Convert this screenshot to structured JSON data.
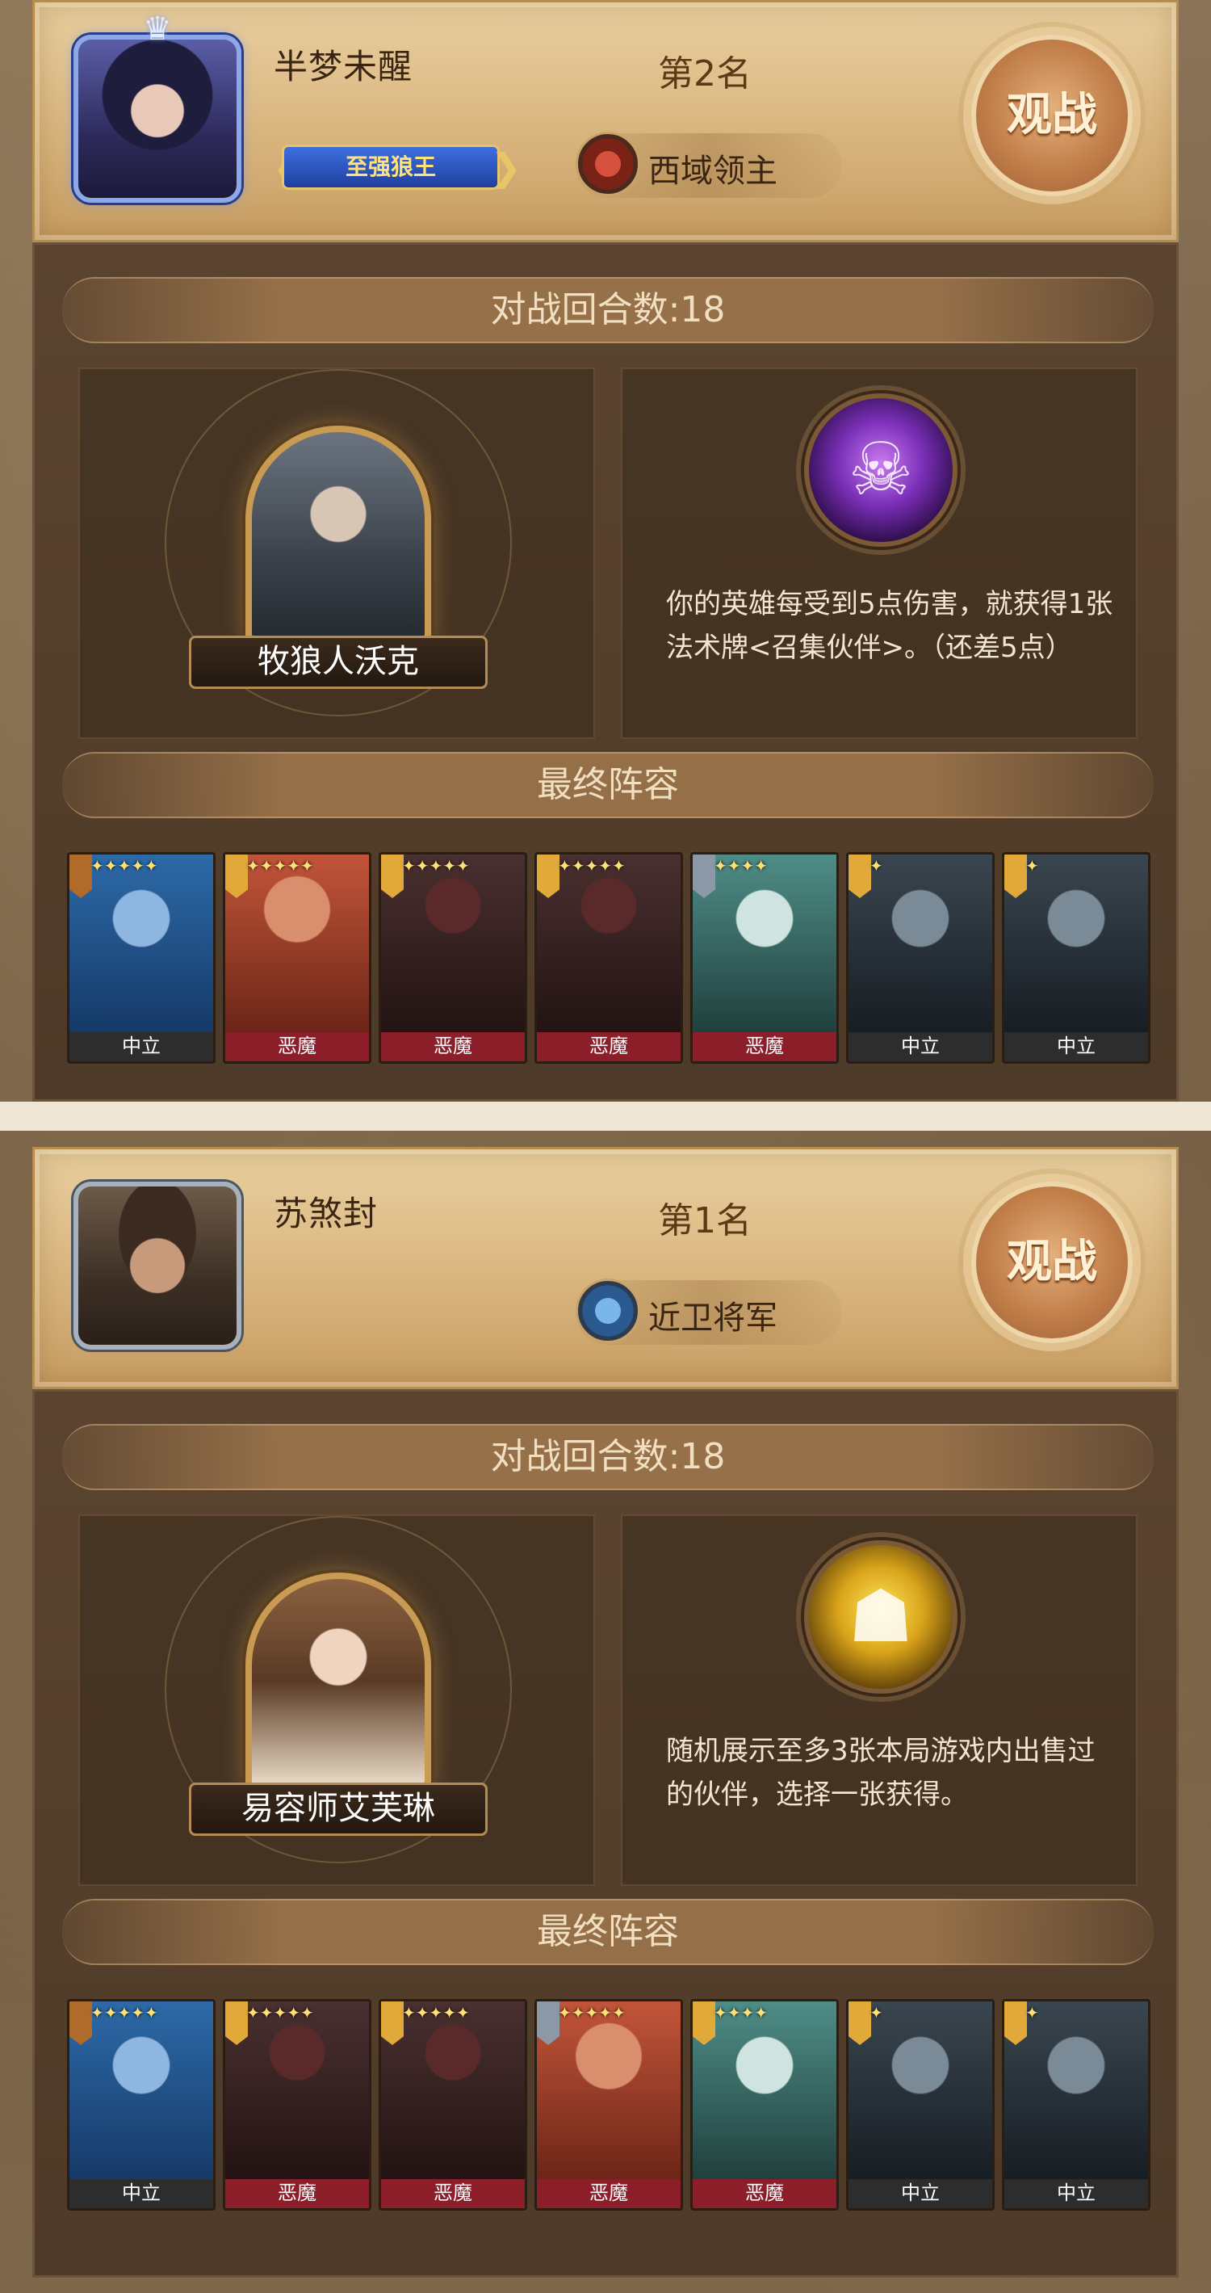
{
  "colors": {
    "accent_gold": "#d9b57e",
    "demon_red": "#8c1e2a",
    "neutral_grey": "#2d2d2d",
    "watch_button": "#c27f4a"
  },
  "players": [
    {
      "name": "半梦未醒",
      "rank_badge": "至强狼王",
      "place": "第2名",
      "title": "西域领主",
      "title_icon": "red-emblem-icon",
      "watch_label": "观战",
      "rounds": "对战回合数:18",
      "hero_name": "牧狼人沃克",
      "skill_icon": "purple-summon-icon",
      "skill_text": "你的英雄每受到5点伤害，就获得1张法术牌<召集伙伴>。（还差5点）",
      "lineup_title": "最终阵容",
      "cards": [
        {
          "faction": "中立",
          "stars": "✦✦✦✦✦",
          "art": "a",
          "tag": "orange"
        },
        {
          "faction": "恶魔",
          "stars": "✦✦✦✦✦",
          "art": "b",
          "tag": "gold"
        },
        {
          "faction": "恶魔",
          "stars": "✦✦✦✦✦",
          "art": "c",
          "tag": "gold"
        },
        {
          "faction": "恶魔",
          "stars": "✦✦✦✦✦",
          "art": "c",
          "tag": "gold"
        },
        {
          "faction": "恶魔",
          "stars": "✦✦✦✦",
          "art": "d",
          "tag": "silver"
        },
        {
          "faction": "中立",
          "stars": "✦",
          "art": "e",
          "tag": "gold"
        },
        {
          "faction": "中立",
          "stars": "✦",
          "art": "e",
          "tag": "gold"
        }
      ]
    },
    {
      "name": "苏煞封",
      "place": "第1名",
      "title": "近卫将军",
      "title_icon": "blue-emblem-icon",
      "watch_label": "观战",
      "rounds": "对战回合数:18",
      "hero_name": "易容师艾芙琳",
      "skill_icon": "gold-mask-icon",
      "skill_text": "随机展示至多3张本局游戏内出售过的伙伴，选择一张获得。",
      "lineup_title": "最终阵容",
      "cards": [
        {
          "faction": "中立",
          "stars": "✦✦✦✦✦",
          "art": "a",
          "tag": "orange"
        },
        {
          "faction": "恶魔",
          "stars": "✦✦✦✦✦",
          "art": "c",
          "tag": "gold"
        },
        {
          "faction": "恶魔",
          "stars": "✦✦✦✦✦",
          "art": "c",
          "tag": "gold"
        },
        {
          "faction": "恶魔",
          "stars": "✦✦✦✦✦",
          "art": "b",
          "tag": "silver"
        },
        {
          "faction": "恶魔",
          "stars": "✦✦✦✦",
          "art": "d",
          "tag": "gold"
        },
        {
          "faction": "中立",
          "stars": "✦",
          "art": "e",
          "tag": "gold"
        },
        {
          "faction": "中立",
          "stars": "✦",
          "art": "e",
          "tag": "gold"
        }
      ]
    }
  ]
}
